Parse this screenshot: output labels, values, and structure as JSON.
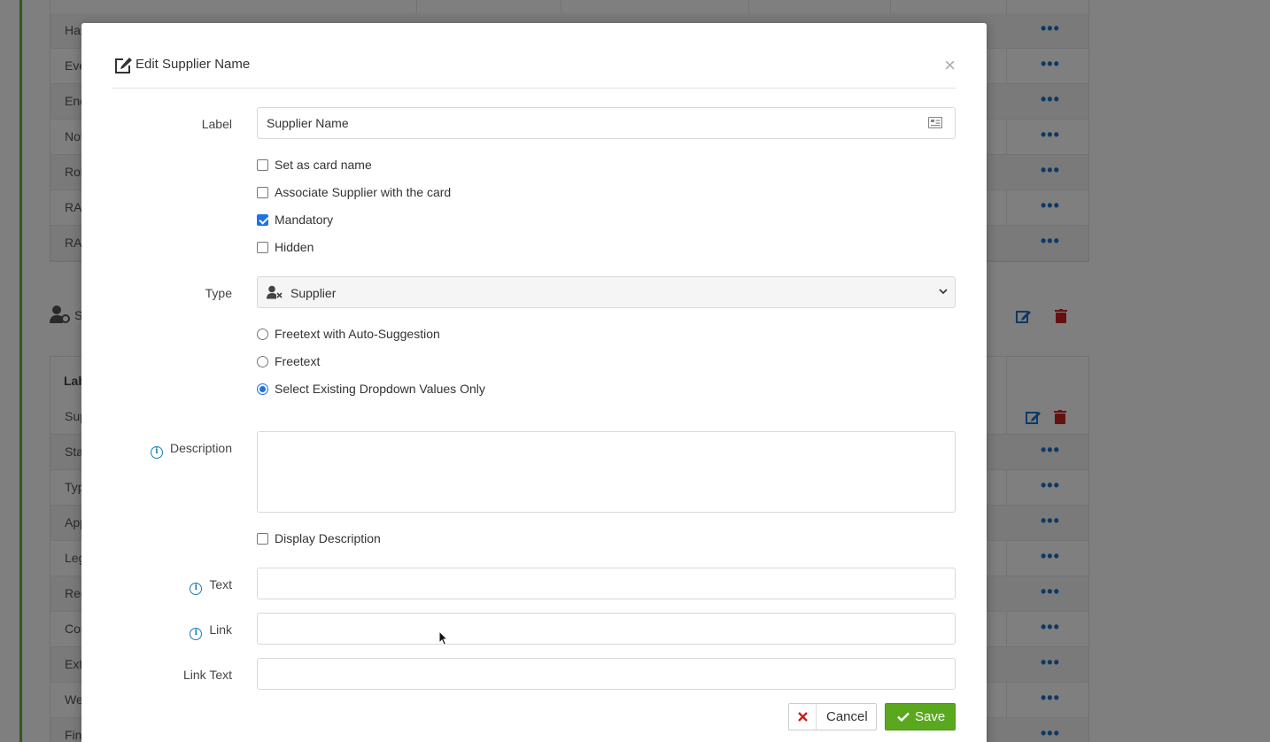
{
  "background": {
    "rows_top": [
      "Has",
      "Eve",
      "Enc",
      "Not",
      "Rol",
      "RAG",
      "RAG"
    ],
    "section_label": "S",
    "header_label": "Lab",
    "rows_bottom": [
      "Sup",
      "Sta",
      "Typ",
      "App",
      "Leg",
      "Reg",
      "Cor",
      "Ext",
      "We",
      "Fin"
    ],
    "dots": "•••"
  },
  "modal": {
    "title": "Edit Supplier Name",
    "close": "×",
    "label_field": {
      "label": "Label",
      "value": "Supplier Name"
    },
    "checkboxes": [
      {
        "label": "Set as card name",
        "checked": false
      },
      {
        "label": "Associate Supplier with the card",
        "checked": false
      },
      {
        "label": "Mandatory",
        "checked": true
      },
      {
        "label": "Hidden",
        "checked": false
      }
    ],
    "type_field": {
      "label": "Type",
      "value": "Supplier"
    },
    "radios": [
      {
        "label": "Freetext with Auto-Suggestion",
        "checked": false
      },
      {
        "label": "Freetext",
        "checked": false
      },
      {
        "label": "Select Existing Dropdown Values Only",
        "checked": true
      }
    ],
    "description": {
      "label": "Description",
      "value": ""
    },
    "display_description": {
      "label": "Display Description",
      "checked": false
    },
    "text_field": {
      "label": "Text",
      "value": ""
    },
    "link_field": {
      "label": "Link",
      "value": ""
    },
    "link_text_field": {
      "label": "Link Text",
      "value": ""
    },
    "cancel_label": "Cancel",
    "save_label": "Save",
    "info_glyph": "i"
  },
  "colors": {
    "accent": "#1a73e8",
    "save": "#5aa81e",
    "cancel_x": "#d01c1c",
    "link_blue": "#1a73c9",
    "delete_red": "#cc2222"
  },
  "icons": [
    "edit-square-icon",
    "close-icon",
    "id-card-icon",
    "user-gear-icon",
    "chevron-down-icon",
    "info-icon",
    "x-icon",
    "check-icon",
    "more-dots-icon",
    "trash-icon",
    "mouse-cursor-icon"
  ]
}
